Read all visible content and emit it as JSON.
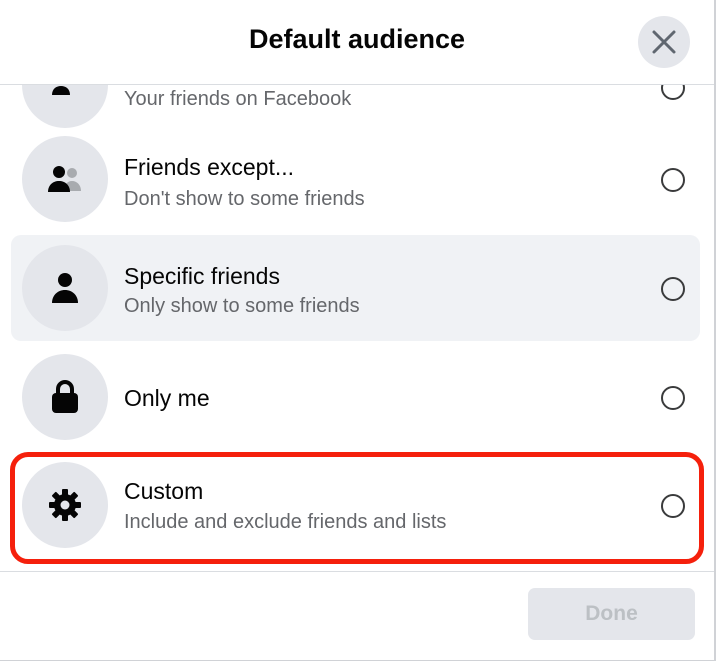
{
  "dialog": {
    "title": "Default audience",
    "close_icon": "close-icon"
  },
  "options": [
    {
      "title": "",
      "subtitle": "Your friends on Facebook",
      "icon": "friends-icon",
      "selected": false
    },
    {
      "title": "Friends except...",
      "subtitle": "Don't show to some friends",
      "icon": "friends-except-icon",
      "selected": false
    },
    {
      "title": "Specific friends",
      "subtitle": "Only show to some friends",
      "icon": "person-icon",
      "selected": false
    },
    {
      "title": "Only me",
      "subtitle": "",
      "icon": "lock-icon",
      "selected": false
    },
    {
      "title": "Custom",
      "subtitle": "Include and exclude friends and lists",
      "icon": "gear-icon",
      "selected": false
    }
  ],
  "footer": {
    "done_label": "Done",
    "done_enabled": false
  },
  "colors": {
    "annotation_outline": "#f5200c",
    "row_highlight": "#f0f2f5",
    "icon_circle": "#e4e6eb"
  }
}
